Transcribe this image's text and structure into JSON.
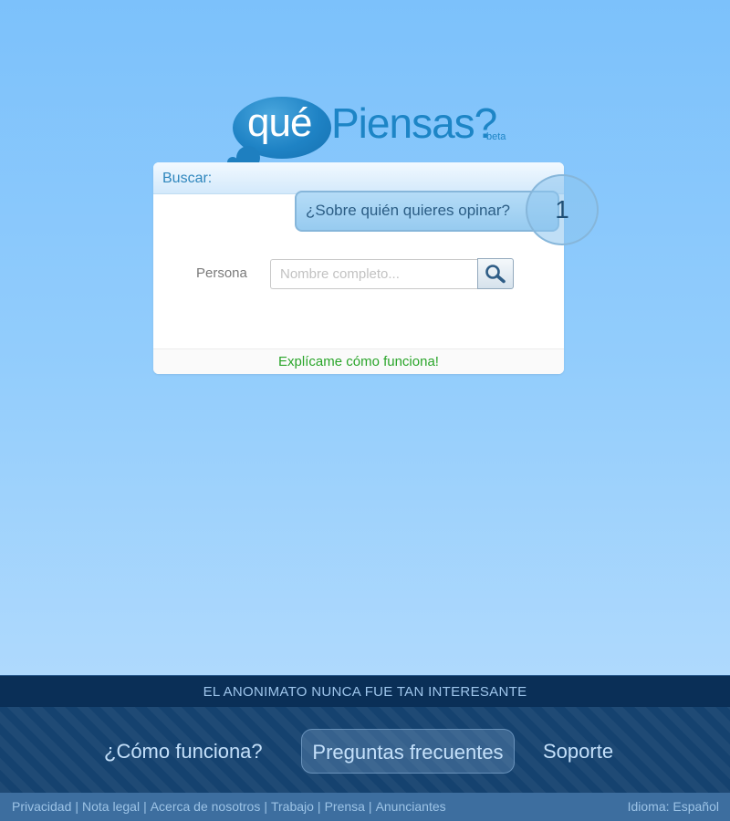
{
  "logo": {
    "que": "qué",
    "piensas": "Piensas?",
    "beta": "beta"
  },
  "search": {
    "header": "Buscar:",
    "field_label": "Persona",
    "placeholder": "Nombre completo...",
    "search_icon": "magnifier-icon",
    "help_link": "Explícame cómo funciona!"
  },
  "tooltip": {
    "text": "¿Sobre quién quieres opinar?",
    "step": "1"
  },
  "footer": {
    "slogan": "EL ANONIMATO NUNCA FUE TAN INTERESANTE",
    "nav": {
      "how": "¿Cómo funciona?",
      "faq": "Preguntas frecuentes",
      "support": "Soporte"
    },
    "links": [
      "Privacidad",
      "Nota legal",
      "Acerca de nosotros",
      "Trabajo",
      "Prensa",
      "Anunciantes"
    ],
    "language": "Idioma: Español"
  },
  "colors": {
    "background_top": "#7cc1fb",
    "background_bottom": "#aed9fd",
    "brand_blue": "#1d85c6",
    "help_green": "#2aa52a",
    "footer_dark": "#0a2f57"
  }
}
